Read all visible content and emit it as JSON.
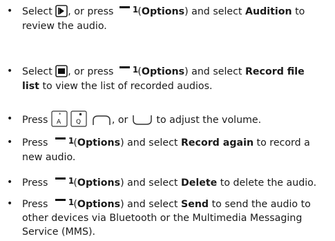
{
  "bullets": "•",
  "icons": [
    "play-icon",
    "record-list-icon",
    "key-volume-up-icon",
    "key-volume-down-icon",
    "send-key-icon",
    "end-key-icon",
    "left-soft-key-icon"
  ],
  "soft_key_number": "1",
  "item1": {
    "l1a": "Select ",
    "l1b": ", or press ",
    "l1c": " (",
    "l1d": "Options",
    "l1e": ") and select ",
    "l1f": "Audition",
    "l1g": " to",
    "l2": "review the audio."
  },
  "item2": {
    "l1a": "Select ",
    "l1b": ", or press ",
    "l1c": " (",
    "l1d": "Options",
    "l1e": ") and select ",
    "l1f": "Record file",
    "l2a": "list",
    "l2b": " to view the list of recorded audios."
  },
  "item3": {
    "l1a": "Press ",
    "l1b": ", or ",
    "l1c": " to adjust the volume."
  },
  "item4": {
    "l1a": "Press ",
    "l1c": " (",
    "l1d": "Options",
    "l1e": ") and select ",
    "l1f": "Record again",
    "l1g": " to record a",
    "l2": "new audio."
  },
  "item5": {
    "l1a": "Press ",
    "l1c": " (",
    "l1d": "Options",
    "l1e": ") and select ",
    "l1f": "Delete",
    "l1g": " to delete the audio."
  },
  "item6": {
    "l1a": "Press ",
    "l1c": " (",
    "l1d": "Options",
    "l1e": ") and select ",
    "l1f": "Send",
    "l1g": " to send the audio to",
    "l2": "other devices via Bluetooth or the Multimedia Messaging",
    "l3": "Service (MMS)."
  }
}
